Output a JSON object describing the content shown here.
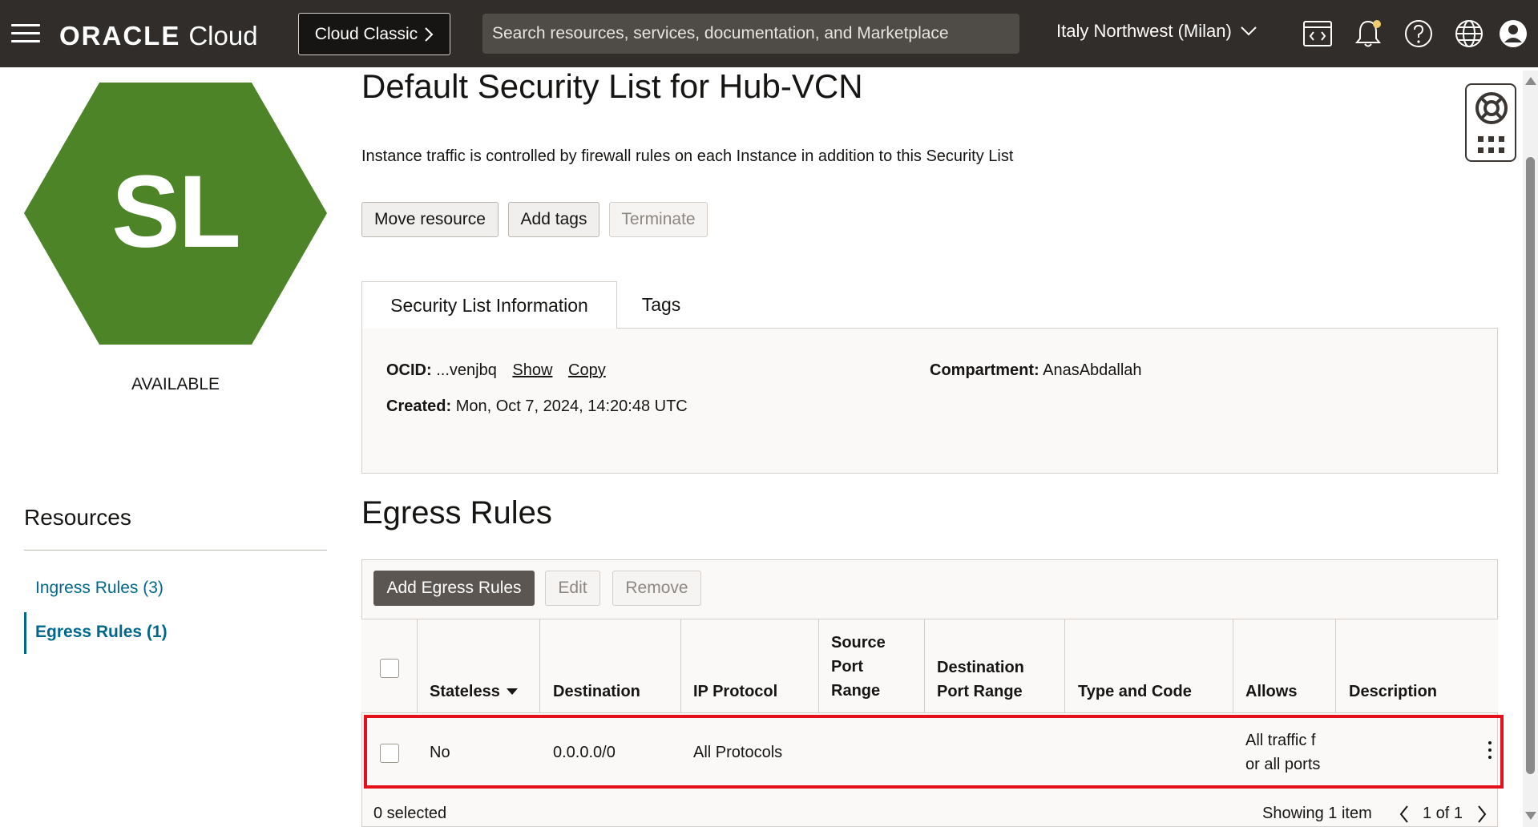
{
  "topbar": {
    "brand_oracle": "ORACLE",
    "brand_cloud": "Cloud",
    "classic_button": "Cloud Classic",
    "search_placeholder": "Search resources, services, documentation, and Marketplace",
    "region": "Italy Northwest (Milan)",
    "icons": [
      "menu-icon",
      "chevron-right-icon",
      "chevron-down-icon",
      "code-editor-icon",
      "bell-icon",
      "help-icon",
      "globe-icon",
      "user-icon"
    ]
  },
  "left": {
    "badge_text": "SL",
    "badge_color": "#4c8427",
    "status": "AVAILABLE",
    "resources_title": "Resources",
    "resources": [
      {
        "label": "Ingress Rules (3)",
        "active": false
      },
      {
        "label": "Egress Rules (1)",
        "active": true
      }
    ]
  },
  "main": {
    "title": "Default Security List for Hub-VCN",
    "description": "Instance traffic is controlled by firewall rules on each Instance in addition to this Security List",
    "actions": {
      "move": "Move resource",
      "tags": "Add tags",
      "terminate": "Terminate"
    },
    "tabs": [
      {
        "label": "Security List Information",
        "active": true
      },
      {
        "label": "Tags",
        "active": false
      }
    ],
    "info": {
      "ocid_label": "OCID:",
      "ocid_value": "...venjbq",
      "show_link": "Show",
      "copy_link": "Copy",
      "created_label": "Created:",
      "created_value": "Mon, Oct 7, 2024, 14:20:48 UTC",
      "compartment_label": "Compartment:",
      "compartment_value": "AnasAbdallah"
    },
    "egress": {
      "title": "Egress Rules",
      "add_button": "Add Egress Rules",
      "edit_button": "Edit",
      "remove_button": "Remove",
      "columns": {
        "stateless": "Stateless",
        "destination": "Destination",
        "ip_protocol": "IP Protocol",
        "source_port_1": "Source",
        "source_port_2": "Port",
        "source_port_3": "Range",
        "dest_port_1": "Destination",
        "dest_port_2": "Port Range",
        "type_code": "Type and Code",
        "allows": "Allows",
        "description": "Description"
      },
      "rows": [
        {
          "stateless": "No",
          "destination": "0.0.0.0/0",
          "ip_protocol": "All Protocols",
          "source_port_range": "",
          "destination_port_range": "",
          "type_and_code": "",
          "allows_line1": "All traffic f",
          "allows_line2": "or all ports",
          "description": ""
        }
      ],
      "selected_text": "0 selected",
      "showing_text": "Showing 1 item",
      "pagination": "1 of 1",
      "highlight_color": "#e4111b"
    }
  },
  "right": {
    "icons": [
      "lifebuoy-icon",
      "apps-grid-icon"
    ]
  }
}
